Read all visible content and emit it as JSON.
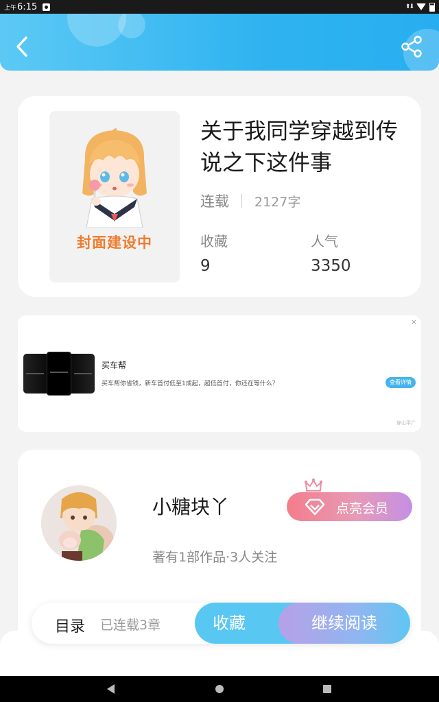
{
  "status_bar": {
    "time_prefix": "上午",
    "time": "6:15"
  },
  "book": {
    "title": "关于我同学穿越到传说之下这件事",
    "status": "连载",
    "word_count": "2127字",
    "cover_text": "封面建设中",
    "favorites_label": "收藏",
    "favorites_value": "9",
    "popularity_label": "人气",
    "popularity_value": "3350"
  },
  "ad": {
    "close": "×",
    "title": "买车帮",
    "description": "买车帮你省钱，新车首付低至1成起，超低首付，你还在等什么？",
    "button": "查看详情",
    "source": "穿山甲广"
  },
  "author": {
    "name": "小糖块丫",
    "stats": "著有1部作品·3人关注",
    "vip_button": "点亮会员"
  },
  "bottom_bar": {
    "toc": "目录",
    "chapters": "已连载3章",
    "favorite": "收藏",
    "continue": "继续阅读"
  },
  "colors": {
    "header": "#2fb3f0",
    "accent": "#58c7f2",
    "vip": "#f47d8b",
    "cover_text": "#f07b2c"
  },
  "icons": [
    "back-arrow-icon",
    "share-icon",
    "crown-icon",
    "diamond-icon",
    "nav-back-icon",
    "nav-home-icon",
    "nav-recent-icon"
  ]
}
